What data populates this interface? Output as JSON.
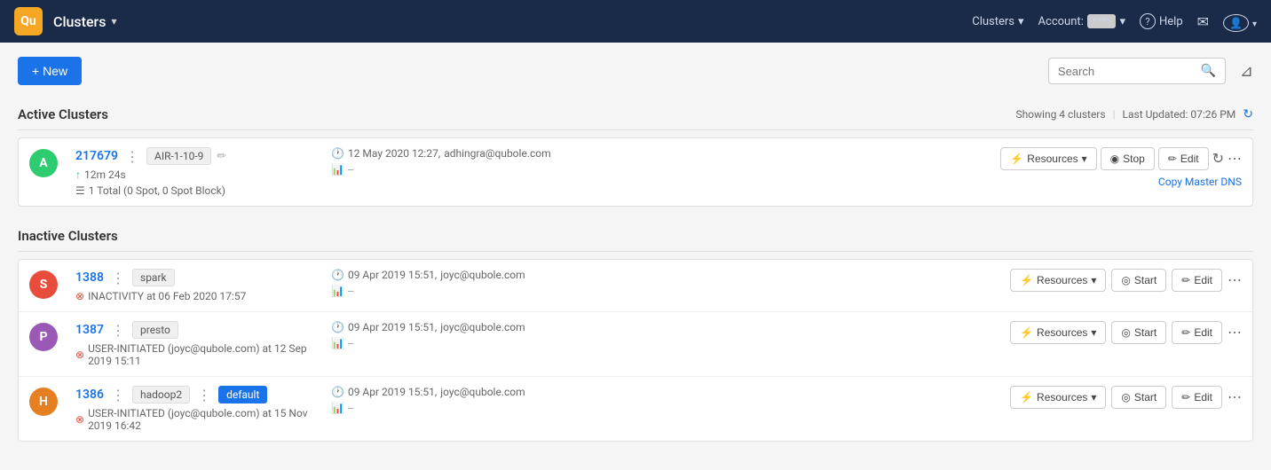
{
  "nav": {
    "logo": "Qu",
    "title": "Clusters",
    "chevron": "▾",
    "clusters_link": "Clusters",
    "account_label": "Account:",
    "account_value": "****",
    "help": "Help",
    "question_icon": "?",
    "message_icon": "✉",
    "user_icon": "👤"
  },
  "toolbar": {
    "new_button": "+ New",
    "search_placeholder": "Search",
    "filter_icon": "▽"
  },
  "active_section": {
    "title": "Active Clusters",
    "showing": "Showing 4 clusters",
    "last_updated": "Last Updated: 07:26 PM"
  },
  "inactive_section": {
    "title": "Inactive Clusters"
  },
  "active_clusters": [
    {
      "avatar_letter": "A",
      "avatar_class": "avatar-green",
      "id": "217679",
      "tag": "AIR-1-10-9",
      "uptime": "12m 24s",
      "node_info": "1 Total (0 Spot, 0 Spot Block)",
      "timestamp": "12 May 2020 12:27,",
      "user": "adhingra@qubole.com",
      "chart": "--",
      "copy_dns": "Copy Master DNS",
      "actions": {
        "resources": "Resources",
        "stop": "Stop",
        "edit": "Edit"
      }
    }
  ],
  "inactive_clusters": [
    {
      "avatar_letter": "S",
      "avatar_class": "avatar-red",
      "id": "1388",
      "tag": "spark",
      "status_icon": "⊗",
      "status": "INACTIVITY at 06 Feb 2020 17:57",
      "timestamp": "09 Apr 2019 15:51,",
      "user": "joyc@qubole.com",
      "chart": "--",
      "actions": {
        "resources": "Resources",
        "start": "Start",
        "edit": "Edit"
      }
    },
    {
      "avatar_letter": "P",
      "avatar_class": "avatar-purple",
      "id": "1387",
      "tag": "presto",
      "status_icon": "⊗",
      "status": "USER-INITIATED (joyc@qubole.com) at 12 Sep 2019 15:11",
      "timestamp": "09 Apr 2019 15:51,",
      "user": "joyc@qubole.com",
      "chart": "--",
      "actions": {
        "resources": "Resources",
        "start": "Start",
        "edit": "Edit"
      }
    },
    {
      "avatar_letter": "H",
      "avatar_class": "avatar-orange",
      "id": "1386",
      "tag": "hadoop2",
      "tag2": "default",
      "status_icon": "⊗",
      "status": "USER-INITIATED (joyc@qubole.com) at 15 Nov 2019 16:42",
      "timestamp": "09 Apr 2019 15:51,",
      "user": "joyc@qubole.com",
      "chart": "--",
      "actions": {
        "resources": "Resources",
        "start": "Start",
        "edit": "Edit"
      }
    }
  ]
}
